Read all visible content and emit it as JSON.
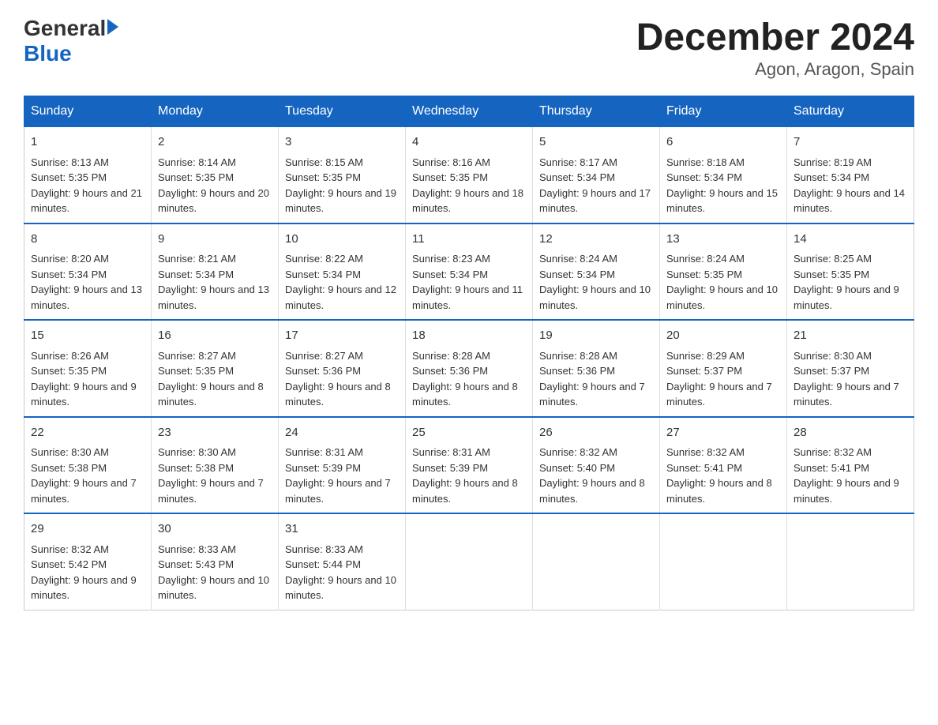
{
  "header": {
    "logo_general": "General",
    "logo_blue": "Blue",
    "month_title": "December 2024",
    "location": "Agon, Aragon, Spain"
  },
  "days_of_week": [
    "Sunday",
    "Monday",
    "Tuesday",
    "Wednesday",
    "Thursday",
    "Friday",
    "Saturday"
  ],
  "weeks": [
    [
      {
        "day": "1",
        "sunrise": "8:13 AM",
        "sunset": "5:35 PM",
        "daylight": "9 hours and 21 minutes."
      },
      {
        "day": "2",
        "sunrise": "8:14 AM",
        "sunset": "5:35 PM",
        "daylight": "9 hours and 20 minutes."
      },
      {
        "day": "3",
        "sunrise": "8:15 AM",
        "sunset": "5:35 PM",
        "daylight": "9 hours and 19 minutes."
      },
      {
        "day": "4",
        "sunrise": "8:16 AM",
        "sunset": "5:35 PM",
        "daylight": "9 hours and 18 minutes."
      },
      {
        "day": "5",
        "sunrise": "8:17 AM",
        "sunset": "5:34 PM",
        "daylight": "9 hours and 17 minutes."
      },
      {
        "day": "6",
        "sunrise": "8:18 AM",
        "sunset": "5:34 PM",
        "daylight": "9 hours and 15 minutes."
      },
      {
        "day": "7",
        "sunrise": "8:19 AM",
        "sunset": "5:34 PM",
        "daylight": "9 hours and 14 minutes."
      }
    ],
    [
      {
        "day": "8",
        "sunrise": "8:20 AM",
        "sunset": "5:34 PM",
        "daylight": "9 hours and 13 minutes."
      },
      {
        "day": "9",
        "sunrise": "8:21 AM",
        "sunset": "5:34 PM",
        "daylight": "9 hours and 13 minutes."
      },
      {
        "day": "10",
        "sunrise": "8:22 AM",
        "sunset": "5:34 PM",
        "daylight": "9 hours and 12 minutes."
      },
      {
        "day": "11",
        "sunrise": "8:23 AM",
        "sunset": "5:34 PM",
        "daylight": "9 hours and 11 minutes."
      },
      {
        "day": "12",
        "sunrise": "8:24 AM",
        "sunset": "5:34 PM",
        "daylight": "9 hours and 10 minutes."
      },
      {
        "day": "13",
        "sunrise": "8:24 AM",
        "sunset": "5:35 PM",
        "daylight": "9 hours and 10 minutes."
      },
      {
        "day": "14",
        "sunrise": "8:25 AM",
        "sunset": "5:35 PM",
        "daylight": "9 hours and 9 minutes."
      }
    ],
    [
      {
        "day": "15",
        "sunrise": "8:26 AM",
        "sunset": "5:35 PM",
        "daylight": "9 hours and 9 minutes."
      },
      {
        "day": "16",
        "sunrise": "8:27 AM",
        "sunset": "5:35 PM",
        "daylight": "9 hours and 8 minutes."
      },
      {
        "day": "17",
        "sunrise": "8:27 AM",
        "sunset": "5:36 PM",
        "daylight": "9 hours and 8 minutes."
      },
      {
        "day": "18",
        "sunrise": "8:28 AM",
        "sunset": "5:36 PM",
        "daylight": "9 hours and 8 minutes."
      },
      {
        "day": "19",
        "sunrise": "8:28 AM",
        "sunset": "5:36 PM",
        "daylight": "9 hours and 7 minutes."
      },
      {
        "day": "20",
        "sunrise": "8:29 AM",
        "sunset": "5:37 PM",
        "daylight": "9 hours and 7 minutes."
      },
      {
        "day": "21",
        "sunrise": "8:30 AM",
        "sunset": "5:37 PM",
        "daylight": "9 hours and 7 minutes."
      }
    ],
    [
      {
        "day": "22",
        "sunrise": "8:30 AM",
        "sunset": "5:38 PM",
        "daylight": "9 hours and 7 minutes."
      },
      {
        "day": "23",
        "sunrise": "8:30 AM",
        "sunset": "5:38 PM",
        "daylight": "9 hours and 7 minutes."
      },
      {
        "day": "24",
        "sunrise": "8:31 AM",
        "sunset": "5:39 PM",
        "daylight": "9 hours and 7 minutes."
      },
      {
        "day": "25",
        "sunrise": "8:31 AM",
        "sunset": "5:39 PM",
        "daylight": "9 hours and 8 minutes."
      },
      {
        "day": "26",
        "sunrise": "8:32 AM",
        "sunset": "5:40 PM",
        "daylight": "9 hours and 8 minutes."
      },
      {
        "day": "27",
        "sunrise": "8:32 AM",
        "sunset": "5:41 PM",
        "daylight": "9 hours and 8 minutes."
      },
      {
        "day": "28",
        "sunrise": "8:32 AM",
        "sunset": "5:41 PM",
        "daylight": "9 hours and 9 minutes."
      }
    ],
    [
      {
        "day": "29",
        "sunrise": "8:32 AM",
        "sunset": "5:42 PM",
        "daylight": "9 hours and 9 minutes."
      },
      {
        "day": "30",
        "sunrise": "8:33 AM",
        "sunset": "5:43 PM",
        "daylight": "9 hours and 10 minutes."
      },
      {
        "day": "31",
        "sunrise": "8:33 AM",
        "sunset": "5:44 PM",
        "daylight": "9 hours and 10 minutes."
      },
      null,
      null,
      null,
      null
    ]
  ]
}
